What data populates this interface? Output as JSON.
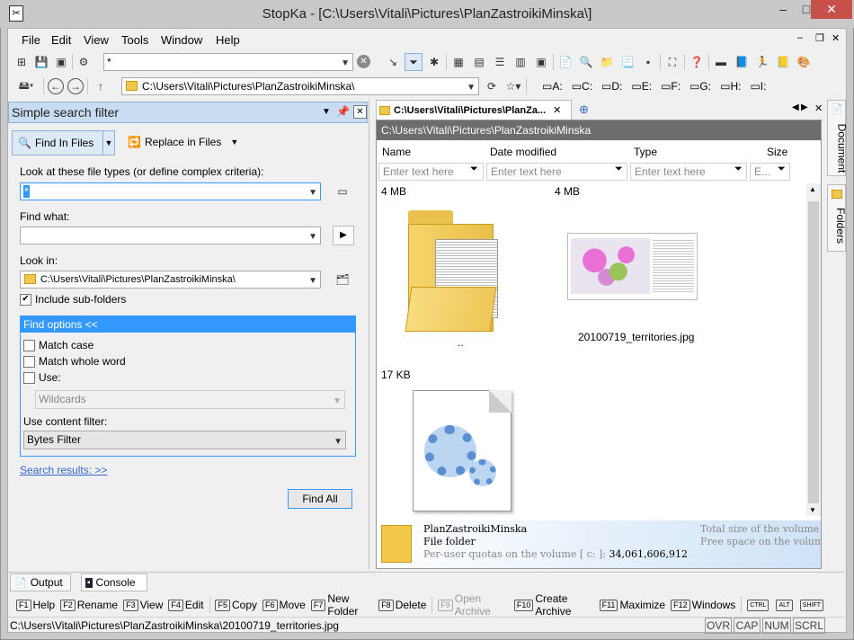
{
  "window": {
    "title": "StopKa - [C:\\Users\\Vitali\\Pictures\\PlanZastroikiMinska\\]",
    "buttons": {
      "minimize": "–",
      "maximize": "□",
      "close": "✕"
    }
  },
  "menu": [
    "File",
    "Edit",
    "View",
    "Tools",
    "Window",
    "Help"
  ],
  "mdi_buttons": {
    "minimize": "–",
    "restore": "❐",
    "close": "✕"
  },
  "toolbar": {
    "filter_value": "*",
    "path_value": "C:\\Users\\Vitali\\Pictures\\PlanZastroikiMinska\\",
    "drives": [
      "A:",
      "C:",
      "D:",
      "E:",
      "F:",
      "G:",
      "H:",
      "I:"
    ]
  },
  "search_panel": {
    "title": "Simple search filter",
    "find_in_files": "Find In Files",
    "replace_in_files": "Replace in Files",
    "file_types_label": "Look at these file types (or define complex criteria):",
    "file_types_value": "*",
    "find_what_label": "Find what:",
    "find_what_value": "",
    "look_in_label": "Look in:",
    "look_in_value": "C:\\Users\\Vitali\\Pictures\\PlanZastroikiMinska\\",
    "include_subfolders": "Include sub-folders",
    "find_options": "Find options <<",
    "match_case": "Match case",
    "match_whole_word": "Match whole word",
    "use": "Use:",
    "wildcards": "Wildcards",
    "content_filter_label": "Use content filter:",
    "content_filter_value": "Bytes Filter",
    "search_results": "Search results: >>",
    "find_all": "Find All"
  },
  "browser": {
    "tab_label": "C:\\Users\\Vitali\\Pictures\\PlanZa...",
    "path_header": "C:\\Users\\Vitali\\Pictures\\PlanZastroikiMinska",
    "columns": [
      "Name",
      "Date modified",
      "Type",
      "Size"
    ],
    "filter_placeholder": "Enter text here",
    "filter_placeholder_short": "E...",
    "items": [
      {
        "size": "4 MB",
        "name": ".."
      },
      {
        "size": "4 MB",
        "name": "20100719_territories.jpg"
      },
      {
        "size": "17 KB",
        "name": ""
      }
    ],
    "info": {
      "name": "PlanZastroikiMinska",
      "type": "File folder",
      "quota": "Per-user quotas on the volume [ c: ]:",
      "quota_value": "34,061,606,912",
      "total_size": "Total size of the volume",
      "free_space": "Free space on the volume"
    }
  },
  "side_tabs": [
    "Document",
    "Folders"
  ],
  "bottom_tabs": [
    "Output",
    "Console"
  ],
  "fkeys": [
    {
      "key": "F1",
      "label": "Help"
    },
    {
      "key": "F2",
      "label": "Rename"
    },
    {
      "key": "F3",
      "label": "View"
    },
    {
      "key": "F4",
      "label": "Edit"
    },
    {
      "key": "F5",
      "label": "Copy"
    },
    {
      "key": "F6",
      "label": "Move"
    },
    {
      "key": "F7",
      "label": "New Folder"
    },
    {
      "key": "F8",
      "label": "Delete"
    },
    {
      "key": "F9",
      "label": "Open Archive"
    },
    {
      "key": "F10",
      "label": "Create Archive"
    },
    {
      "key": "F11",
      "label": "Maximize"
    },
    {
      "key": "F12",
      "label": "Windows"
    }
  ],
  "modkeys": [
    "CTRL",
    "ALT",
    "SHIFT"
  ],
  "status": {
    "path": "C:\\Users\\Vitali\\Pictures\\PlanZastroikiMinska\\20100719_territories.jpg",
    "indicators": [
      "OVR",
      "CAP",
      "NUM",
      "SCRL"
    ]
  },
  "colors": {
    "accent": "#3399ff",
    "panel_head": "#c8dcf2",
    "link": "#3366cc"
  }
}
